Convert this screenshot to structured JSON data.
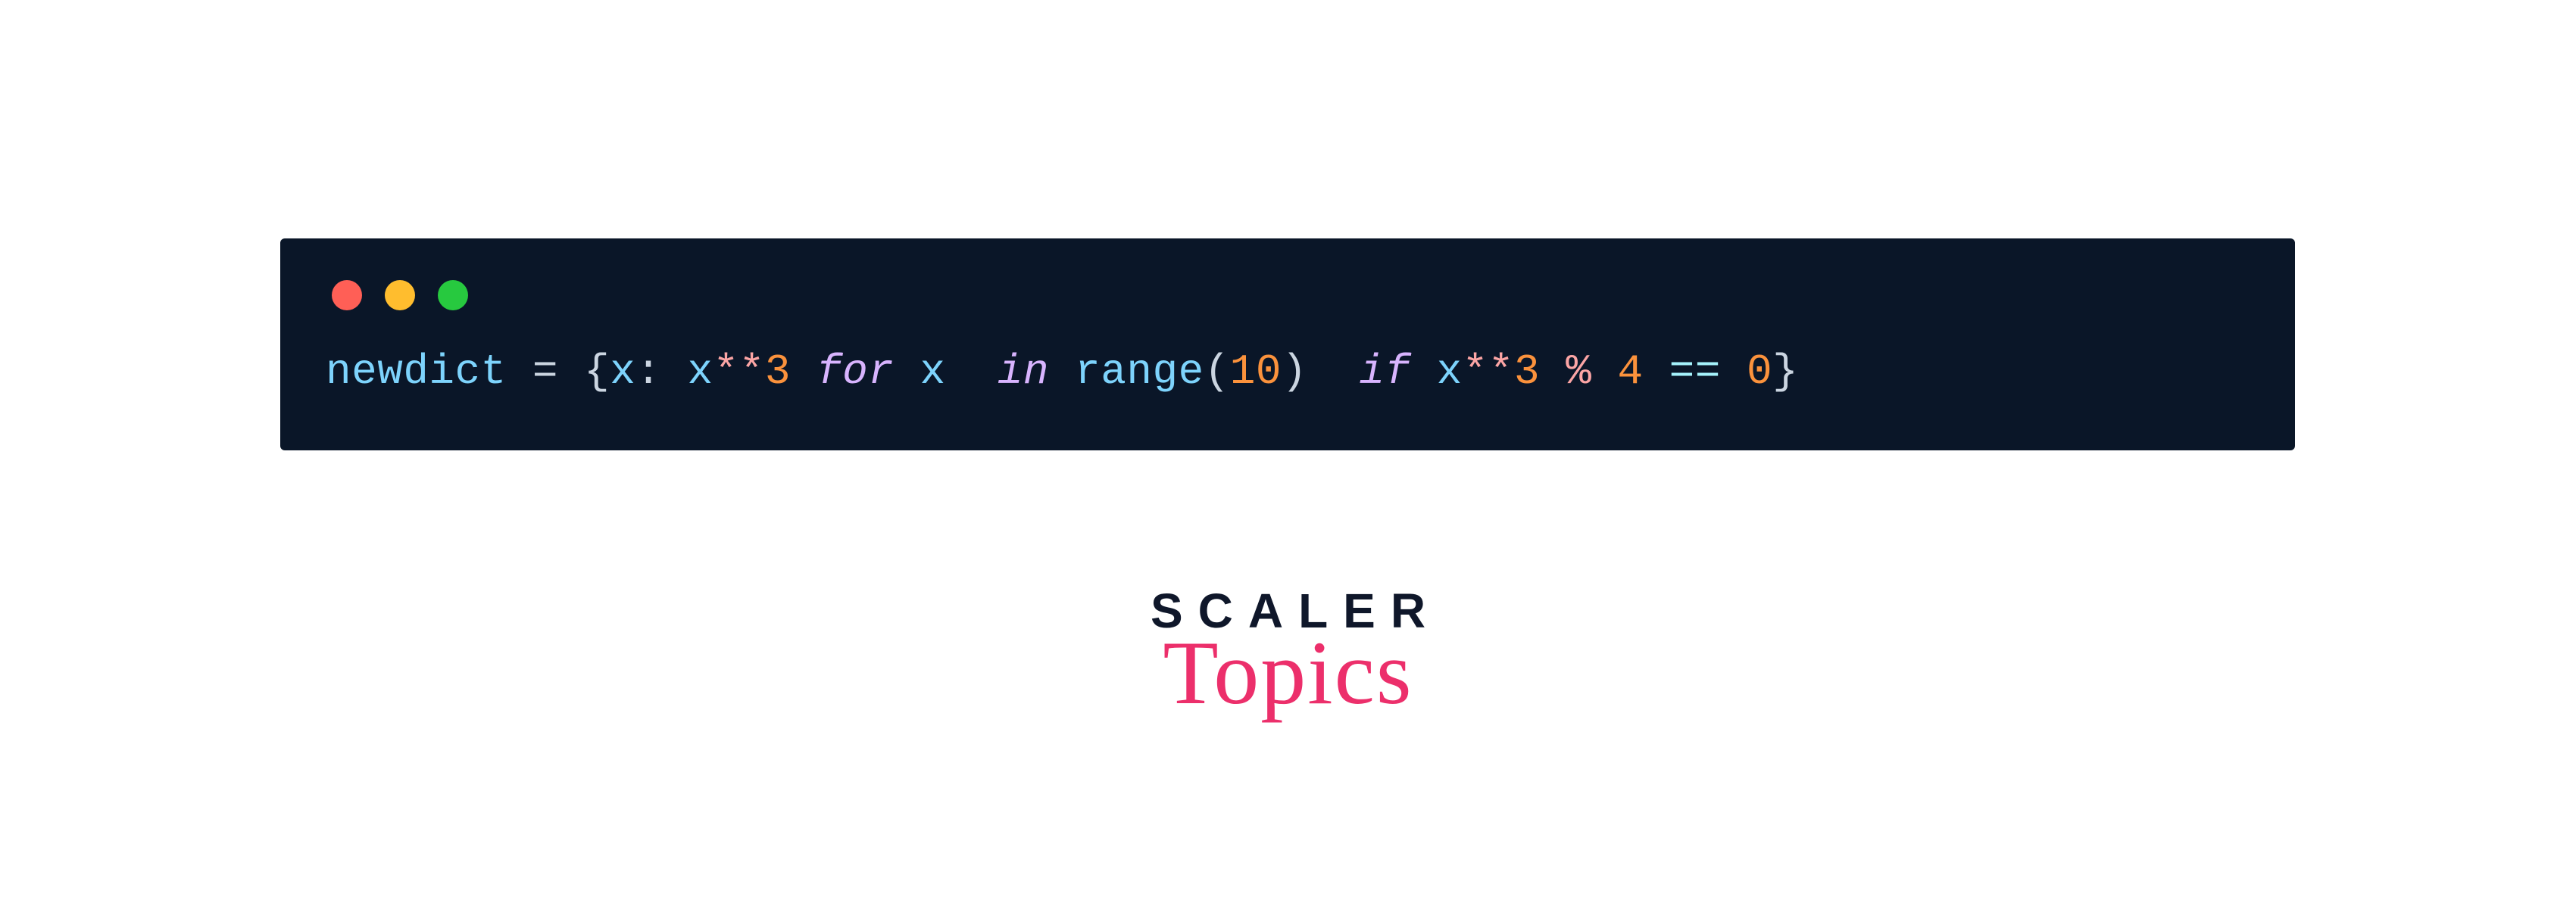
{
  "traffic_dots": {
    "red": "#ff5f56",
    "yellow": "#ffbd2e",
    "green": "#27c93f"
  },
  "code": {
    "var": "newdict",
    "assign": " = ",
    "lbrace": "{",
    "key_expr": "x",
    "colon": ": ",
    "val_ident": "x",
    "pow1": "**",
    "cube1": "3",
    "space1": " ",
    "kw_for": "for",
    "space2": " ",
    "loop_var": "x",
    "space3": "  ",
    "kw_in": "in",
    "space4": " ",
    "range_fn": "range",
    "lparen": "(",
    "range_arg": "10",
    "rparen": ")",
    "space5": "  ",
    "kw_if": "if",
    "space6": " ",
    "cond_ident": "x",
    "pow2": "**",
    "cube2": "3",
    "space7": " ",
    "mod": "%",
    "space8": " ",
    "mod_arg": "4",
    "space9": " ",
    "eqeq": "==",
    "space10": " ",
    "zero": "0",
    "rbrace": "}"
  },
  "brand": {
    "line1": "SCALER",
    "line2": "Topics"
  }
}
